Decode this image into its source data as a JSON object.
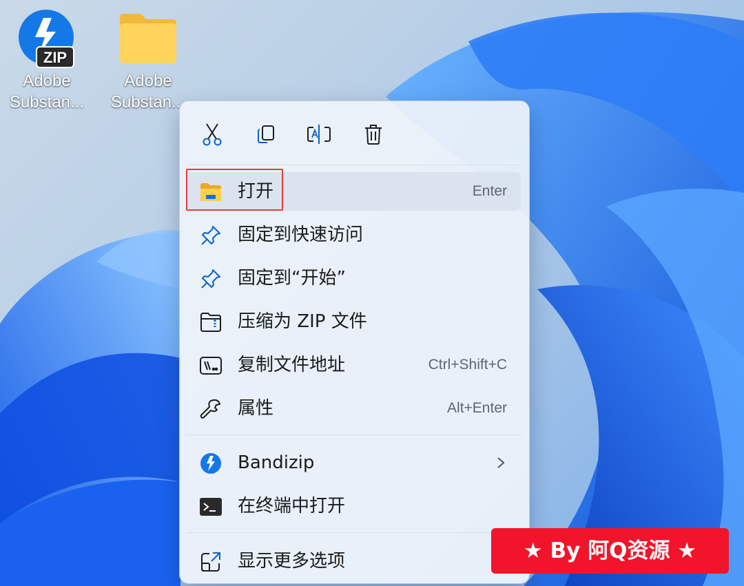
{
  "desktop": {
    "icons": [
      {
        "label": "Adobe\nSubstan…",
        "line1": "Adobe",
        "line2": "Substan...",
        "icon": "bandizip-zip-icon"
      },
      {
        "label": "Adobe",
        "line1": "Adobe",
        "line2": "Substan...",
        "icon": "folder-icon"
      }
    ]
  },
  "context_menu": {
    "toolbar": [
      {
        "icon": "cut-icon"
      },
      {
        "icon": "copy-icon"
      },
      {
        "icon": "rename-icon"
      },
      {
        "icon": "delete-icon"
      }
    ],
    "items": [
      {
        "label": "打开",
        "shortcut": "Enter",
        "icon": "folder-open-icon",
        "highlighted": true
      },
      {
        "label": "固定到快速访问",
        "shortcut": "",
        "icon": "pin-icon"
      },
      {
        "label": "固定到“开始”",
        "shortcut": "",
        "icon": "pin-icon"
      },
      {
        "label": "压缩为 ZIP 文件",
        "shortcut": "",
        "icon": "zip-folder-icon"
      },
      {
        "label": "复制文件地址",
        "shortcut": "Ctrl+Shift+C",
        "icon": "copy-path-icon"
      },
      {
        "label": "属性",
        "shortcut": "Alt+Enter",
        "icon": "wrench-icon"
      },
      {
        "label": "Bandizip",
        "shortcut": "",
        "icon": "bandizip-icon",
        "submenu": true
      },
      {
        "label": "在终端中打开",
        "shortcut": "",
        "icon": "terminal-icon"
      },
      {
        "label": "显示更多选项",
        "shortcut": "",
        "icon": "more-options-icon"
      }
    ]
  },
  "watermark": {
    "text": "★ By 阿Q资源 ★"
  },
  "colors": {
    "accent": "#0067c0",
    "highlight_box": "#e43a3a",
    "watermark_bg": "#f2142a"
  }
}
